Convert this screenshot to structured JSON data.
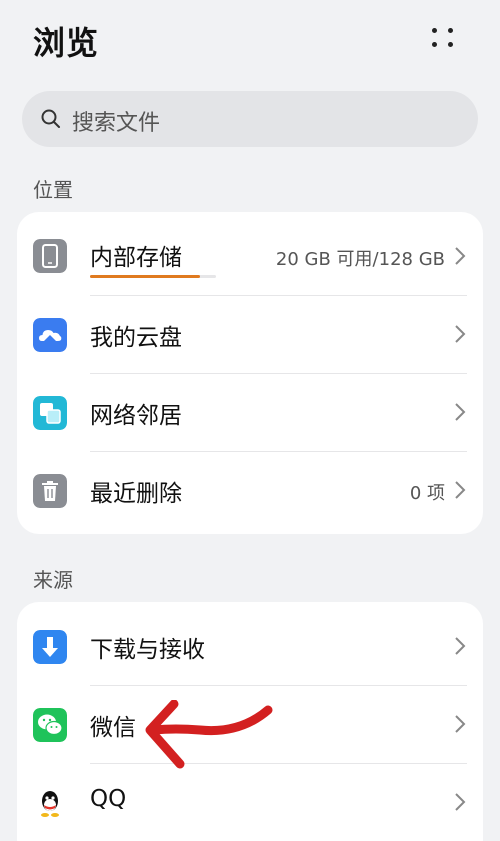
{
  "header": {
    "title": "浏览"
  },
  "search": {
    "placeholder": "搜索文件"
  },
  "sections": {
    "location_label": "位置",
    "source_label": "来源"
  },
  "location_items": [
    {
      "label": "内部存储",
      "meta": "20 GB 可用/128 GB",
      "icon": "phone-icon",
      "storage_used_fraction": 0.87
    },
    {
      "label": "我的云盘",
      "meta": "",
      "icon": "cloud-icon"
    },
    {
      "label": "网络邻居",
      "meta": "",
      "icon": "network-icon"
    },
    {
      "label": "最近删除",
      "meta": "0 项",
      "icon": "trash-icon"
    }
  ],
  "source_items": [
    {
      "label": "下载与接收",
      "icon": "download-icon"
    },
    {
      "label": "微信",
      "icon": "wechat-icon"
    },
    {
      "label": "QQ",
      "icon": "qq-icon"
    }
  ],
  "colors": {
    "accent_orange": "#e07a1f",
    "annotation_red": "#d32020",
    "cloud_blue": "#3a7cf0",
    "network_teal": "#22b8d6",
    "download_blue": "#2f86f0",
    "wechat_green": "#1fc35a"
  }
}
